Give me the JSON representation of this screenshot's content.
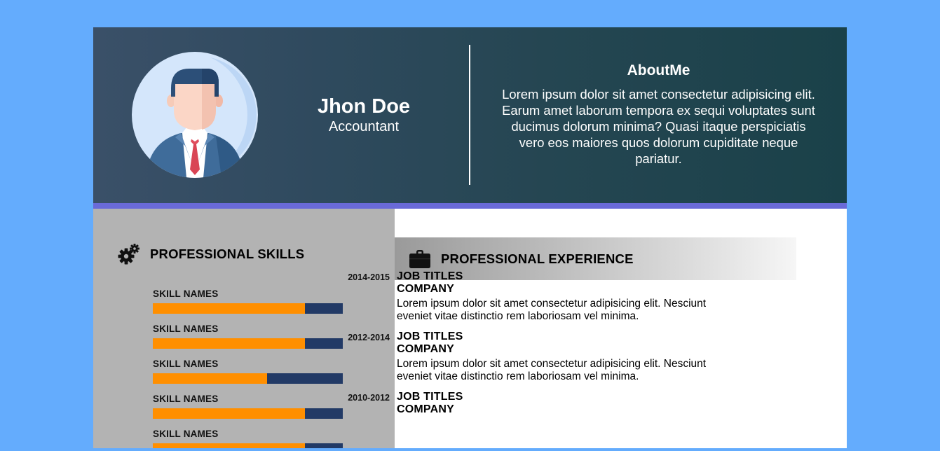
{
  "profile": {
    "name": "Jhon Doe",
    "role": "Accountant",
    "avatar_icon": "person-avatar-icon"
  },
  "about": {
    "title": "AboutMe",
    "text": "Lorem ipsum dolor sit amet consectetur adipisicing elit. Earum amet laborum tempora ex sequi voluptates sunt ducimus dolorum minima? Quasi itaque perspiciatis vero eos maiores quos dolorum cupiditate neque pariatur."
  },
  "skills": {
    "title": "PROFESSIONAL SKILLS",
    "icon": "gears-icon",
    "items": [
      {
        "name": "SKILL NAMES",
        "level": 0.8
      },
      {
        "name": "SKILL NAMES",
        "level": 0.8
      },
      {
        "name": "SKILL NAMES",
        "level": 0.6
      },
      {
        "name": "SKILL NAMES",
        "level": 0.8
      },
      {
        "name": "SKILL NAMES",
        "level": 0.8
      }
    ]
  },
  "experience": {
    "title": "PROFESSIONAL EXPERIENCE",
    "icon": "briefcase-icon",
    "items": [
      {
        "years": "2014-2015",
        "title": "JOB TITLES",
        "company": "COMPANY",
        "description": "Lorem ipsum dolor sit amet consectetur adipisicing elit. Nesciunt eveniet vitae distinctio rem laboriosam vel minima."
      },
      {
        "years": "2012-2014",
        "title": "JOB TITLES",
        "company": "COMPANY",
        "description": "Lorem ipsum dolor sit amet consectetur adipisicing elit. Nesciunt eveniet vitae distinctio rem laboriosam vel minima."
      },
      {
        "years": "2010-2012",
        "title": "JOB TITLES",
        "company": "COMPANY",
        "description": ""
      }
    ]
  },
  "colors": {
    "page_background": "#64acfd",
    "header_start": "#3a5068",
    "header_end": "#1a4149",
    "accent_bar": "#6a6ad8",
    "sidebar": "#b3b3b3",
    "skill_fill": "#ff8f00",
    "skill_track": "#223a66"
  }
}
